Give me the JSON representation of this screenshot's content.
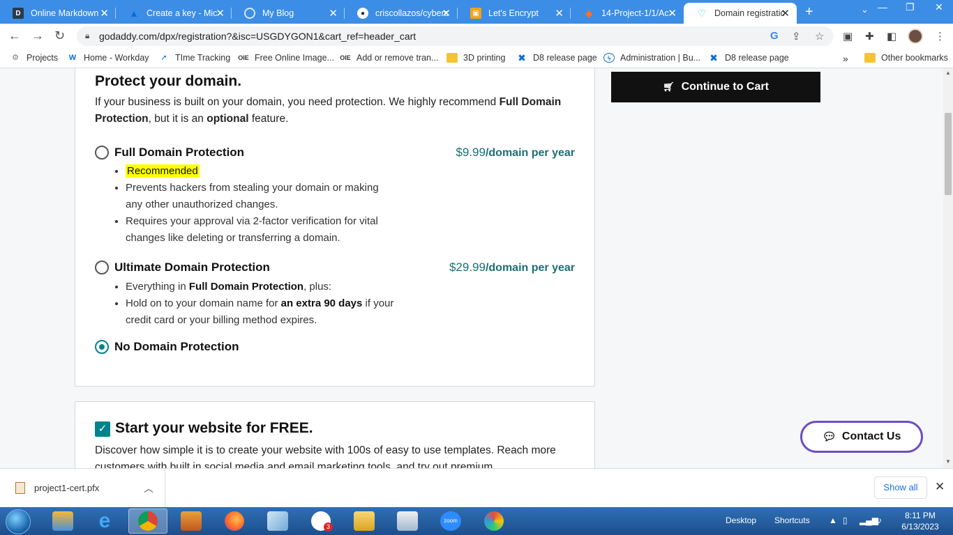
{
  "browser": {
    "tabs": [
      {
        "title": "Online Markdown",
        "favicon": "letter-d-icon"
      },
      {
        "title": "Create a key - Mic",
        "favicon": "azure-icon"
      },
      {
        "title": "My Blog",
        "favicon": "globe-icon"
      },
      {
        "title": "criscollazos/cybers",
        "favicon": "github-icon"
      },
      {
        "title": "Let's Encrypt",
        "favicon": "lets-encrypt-icon"
      },
      {
        "title": "14-Project-1/1/Ac",
        "favicon": "gitlab-icon"
      },
      {
        "title": "Domain registratic",
        "favicon": "godaddy-icon",
        "active": true
      }
    ],
    "url": "godaddy.com/dpx/registration?&isc=USGDYGON1&cart_ref=header_cart",
    "bookmarks": [
      {
        "label": "Projects"
      },
      {
        "label": "Home - Workday"
      },
      {
        "label": "TIme Tracking"
      },
      {
        "label": "Free Online Image..."
      },
      {
        "label": "Add or remove tran..."
      },
      {
        "label": "3D printing"
      },
      {
        "label": "D8 release page"
      },
      {
        "label": "Administration | Bu..."
      },
      {
        "label": "D8 release page"
      },
      {
        "label": "Other bookmarks"
      }
    ]
  },
  "protection": {
    "heading": "Protect your domain.",
    "intro_a": "If your business is built on your domain, you need protection. We highly recommend ",
    "intro_b": "Full Domain Protection",
    "intro_c": ", but it is an ",
    "intro_d": "optional",
    "intro_e": " feature.",
    "options": [
      {
        "label": "Full Domain Protection",
        "price": "$9.99",
        "per": "/domain per year",
        "selected": false,
        "recommended": "Recommended",
        "bullet1": "Prevents hackers from stealing your domain or making any other unauthorized changes.",
        "bullet2": "Requires your approval via 2-factor verification for vital changes like deleting or transferring a domain."
      },
      {
        "label": "Ultimate Domain Protection",
        "price": "$29.99",
        "per": "/domain per year",
        "selected": false,
        "bullet1_a": "Everything in ",
        "bullet1_b": "Full Domain Protection",
        "bullet1_c": ", plus:",
        "bullet2_a": "Hold on to your domain name for ",
        "bullet2_b": "an extra 90 days",
        "bullet2_c": " if your credit card or your billing method expires."
      },
      {
        "label": "No Domain Protection",
        "selected": true
      }
    ]
  },
  "cart_button": "Continue to Cart",
  "website": {
    "checked": true,
    "heading": "Start your website for FREE.",
    "desc": "Discover how simple it is to create your website with 100s of easy to use templates. Reach more customers with built in social media and email marketing tools, and try out premium"
  },
  "contact_button": "Contact Us",
  "downloads": {
    "file": "project1-cert.pfx",
    "show_all": "Show all"
  },
  "taskbar": {
    "desktop": "Desktop",
    "shortcuts": "Shortcuts",
    "time": "8:11 PM",
    "date": "6/13/2023",
    "slack_badge": "3"
  },
  "colors": {
    "accent": "#00838c",
    "price": "#1c6f74",
    "tabstrip": "#3c8de6",
    "contact_border": "#6d4fc4",
    "highlight": "#ffff00"
  }
}
